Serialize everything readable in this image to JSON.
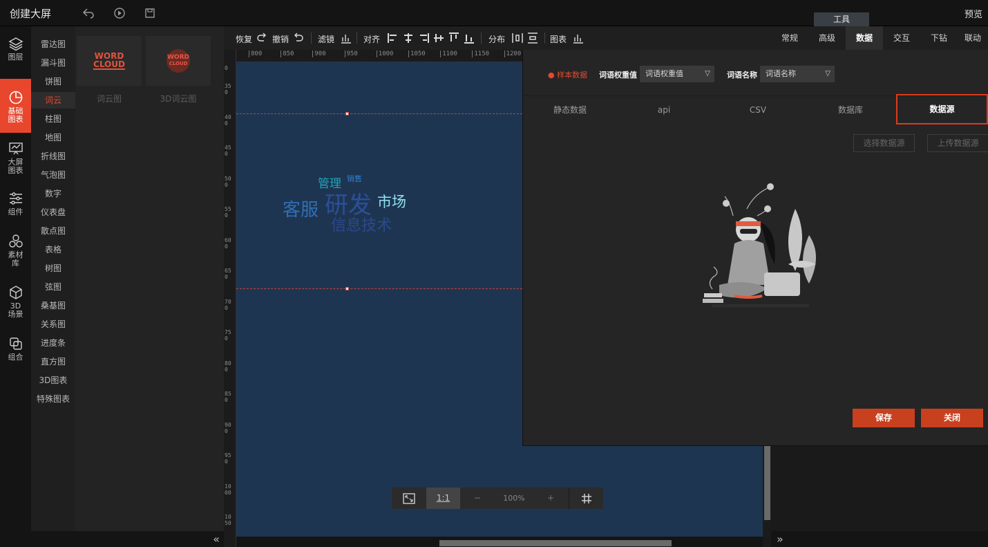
{
  "app": {
    "title": "创建大屏",
    "preview": "预览",
    "tools_tab": "工具"
  },
  "leftnav": [
    {
      "label": "图层",
      "icon": "layers-icon"
    },
    {
      "label": "基础图表",
      "icon": "pie-chart-icon",
      "active": true
    },
    {
      "label": "大屏图表",
      "icon": "screen-chart-icon"
    },
    {
      "label": "组件",
      "icon": "sliders-icon"
    },
    {
      "label": "素材库",
      "icon": "material-icon"
    },
    {
      "label": "3D场景",
      "icon": "cube-icon"
    },
    {
      "label": "组合",
      "icon": "group-icon"
    }
  ],
  "categories": [
    "雷达图",
    "漏斗图",
    "饼图",
    "词云",
    "柱图",
    "地图",
    "折线图",
    "气泡图",
    "数字",
    "仪表盘",
    "散点图",
    "表格",
    "树图",
    "弦图",
    "桑基图",
    "关系图",
    "进度条",
    "直方图",
    "3D图表",
    "特殊图表"
  ],
  "active_category": "词云",
  "thumbnails": [
    {
      "label": "词云图",
      "art_line1": "WORD",
      "art_line2": "CLOUD"
    },
    {
      "label": "3D词云图",
      "art_line1": "WORD",
      "art_line2": "CLOUD"
    }
  ],
  "toolbar": {
    "redo": "恢复",
    "undo": "撤销",
    "filter": "滤镜",
    "align": "对齐",
    "distribute": "分布",
    "chart": "图表"
  },
  "ruler_top": [
    "800",
    "850",
    "900",
    "950",
    "1000",
    "1050",
    "1100",
    "1150",
    "1200"
  ],
  "ruler_left": [
    "0",
    "350",
    "400",
    "450",
    "500",
    "550",
    "600",
    "650",
    "700",
    "750",
    "800",
    "850",
    "900",
    "950",
    "1000",
    "1050"
  ],
  "wordcloud": [
    {
      "text": "管理",
      "color": "#1fa3b8"
    },
    {
      "text": "销售",
      "color": "#2f7fd1"
    },
    {
      "text": "客服",
      "color": "#2f6fb5"
    },
    {
      "text": "研发",
      "color": "#2b4f9a"
    },
    {
      "text": "市场",
      "color": "#8fe3f0"
    },
    {
      "text": "信息技术",
      "color": "#2b4a8f"
    }
  ],
  "zoom": {
    "fit": "fit-icon",
    "ratio": "1:1",
    "minus": "−",
    "value": "100%",
    "plus": "+",
    "grid": "grid-icon"
  },
  "right_tabs": [
    "常规",
    "高级",
    "数据",
    "交互",
    "下钻",
    "联动"
  ],
  "active_right_tab": "数据",
  "data_panel": {
    "sample_label": "样本数据",
    "weight_label": "词语权重值",
    "weight_value": "词语权重值",
    "name_label": "词语名称",
    "name_value": "词语名称",
    "source_tabs": [
      "静态数据",
      "api",
      "CSV",
      "数据库",
      "数据源"
    ],
    "active_source_tab": "数据源",
    "select_source": "选择数据源",
    "upload_source": "上传数据源",
    "save": "保存",
    "close": "关闭"
  }
}
